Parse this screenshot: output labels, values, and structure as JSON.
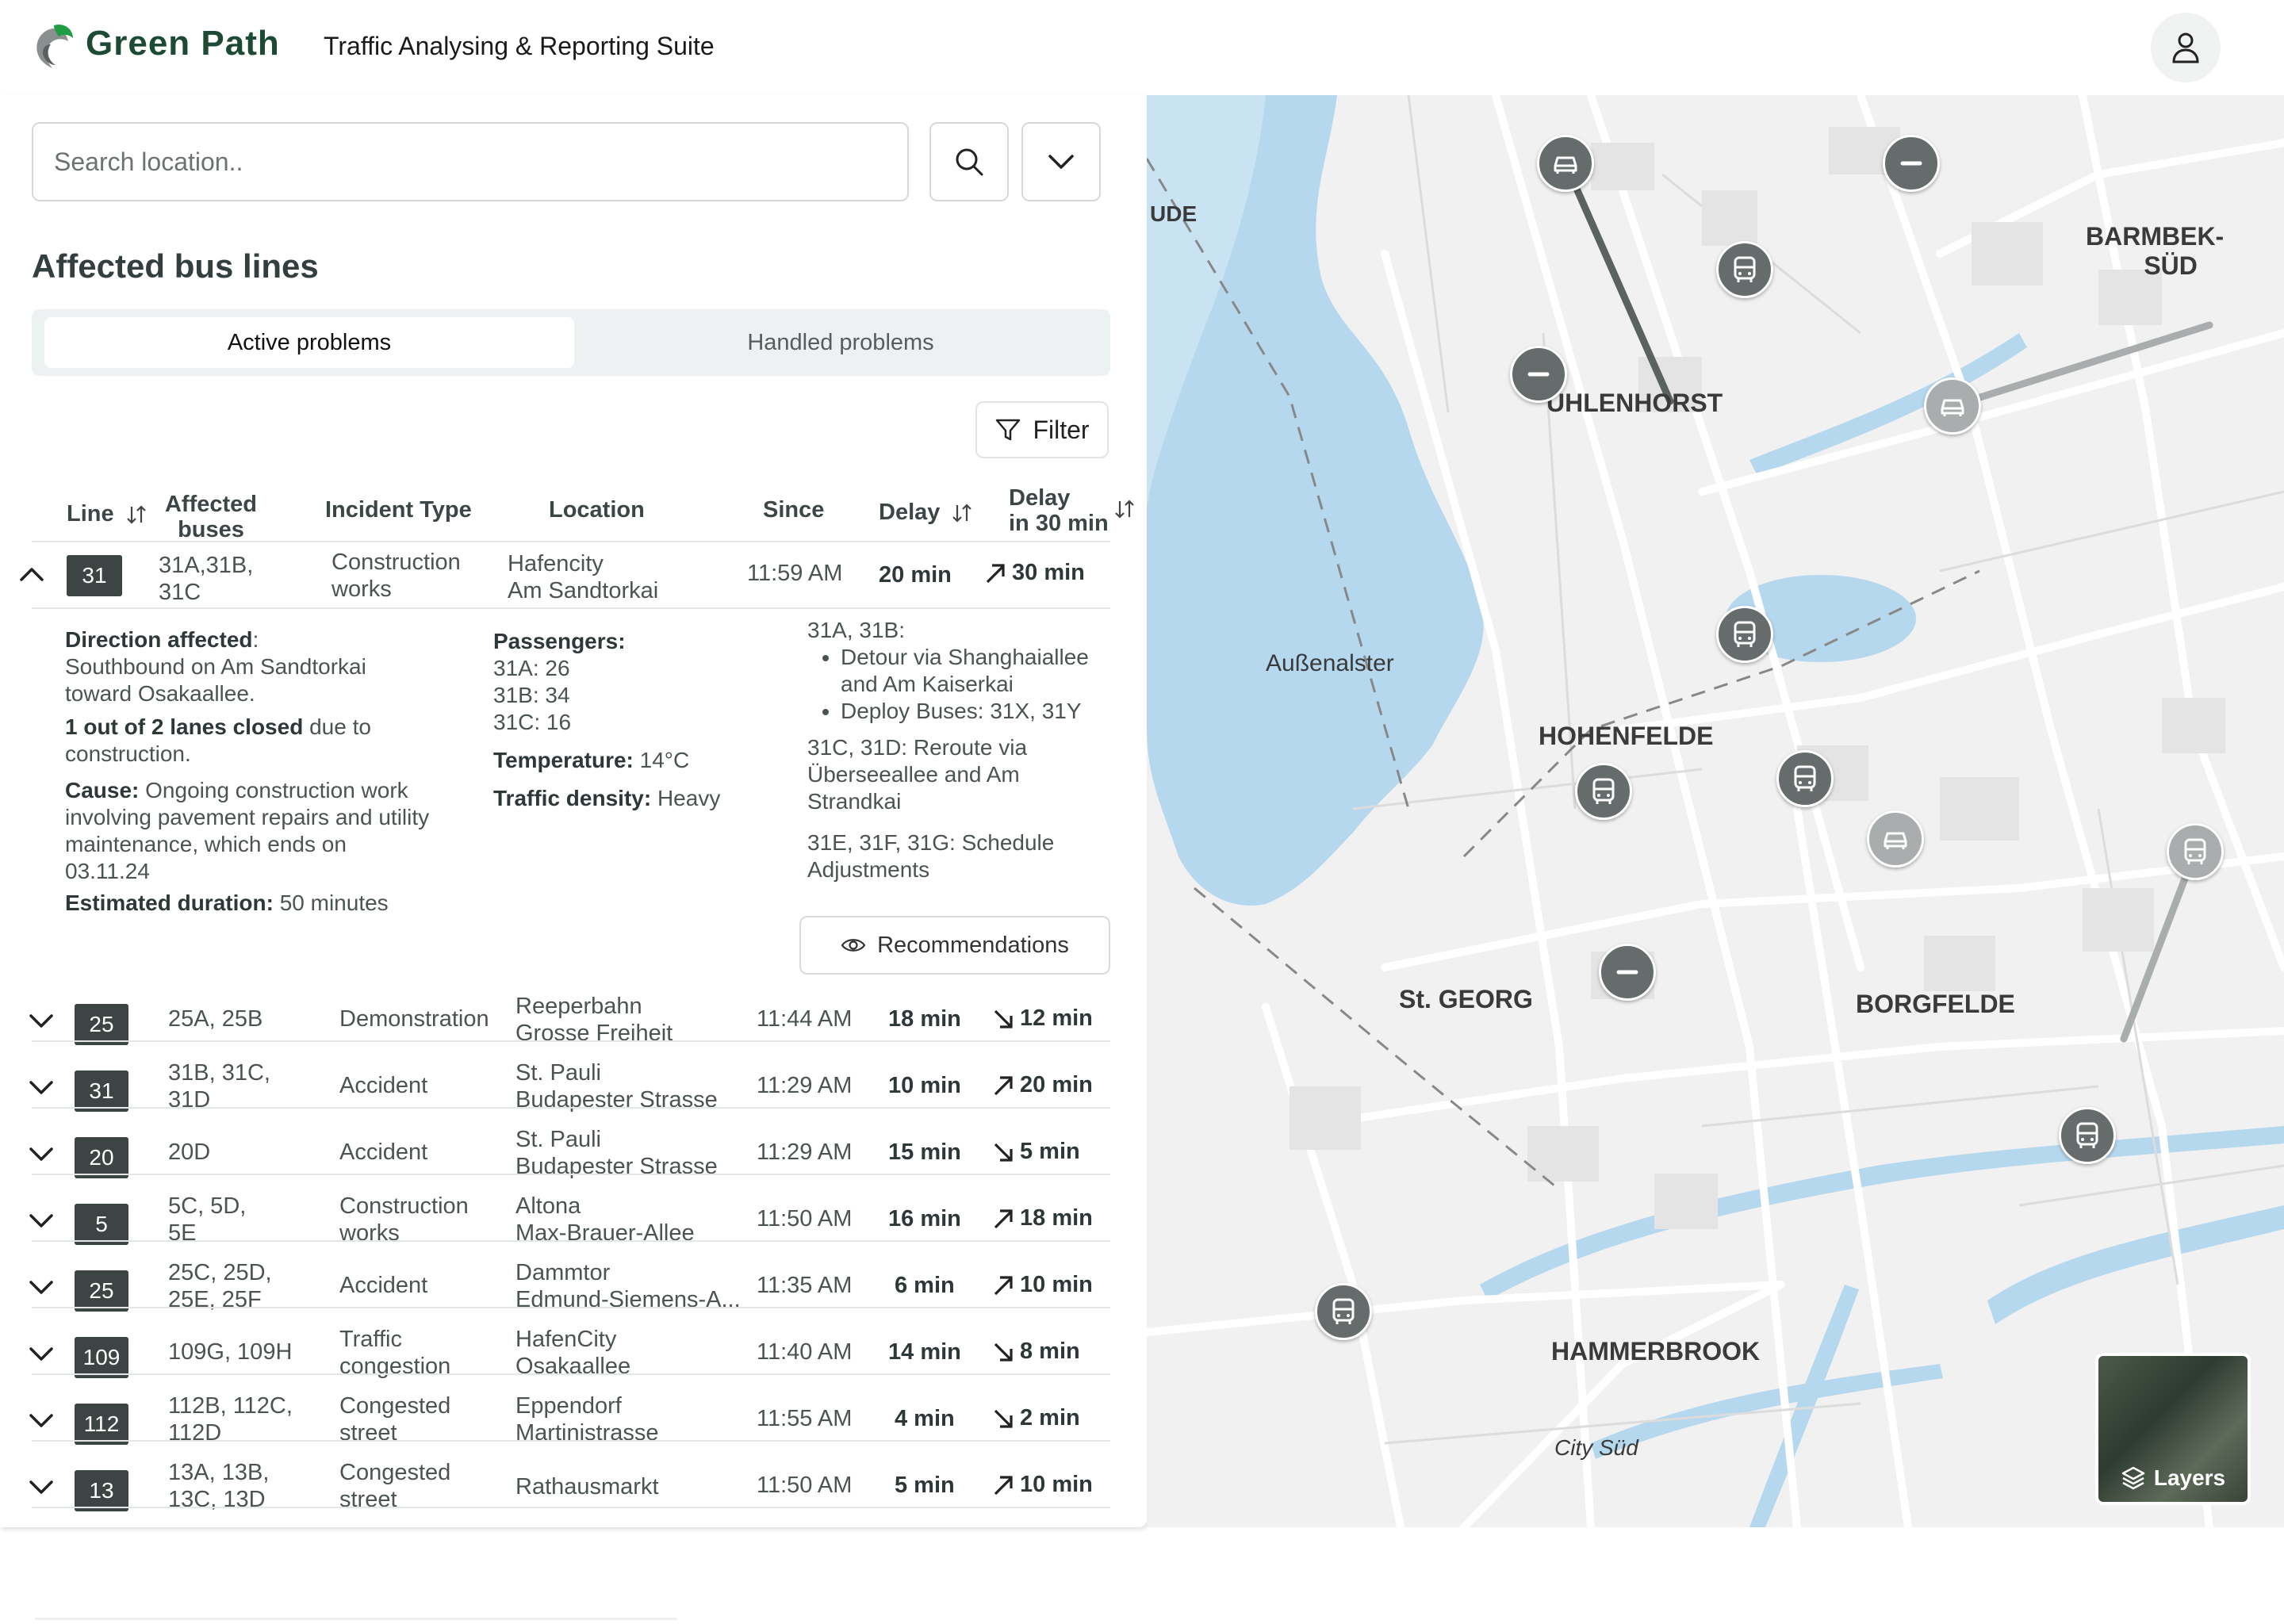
{
  "header": {
    "brand": "Green Path",
    "subtitle": "Traffic Analysing & Reporting Suite"
  },
  "search": {
    "placeholder": "Search location.."
  },
  "panel": {
    "title": "Affected bus lines",
    "tabs": [
      "Active problems",
      "Handled problems"
    ],
    "filter_label": "Filter"
  },
  "table": {
    "headers": {
      "line": "Line",
      "affected_1": "Affected",
      "affected_2": "buses",
      "incident": "Incident Type",
      "location": "Location",
      "since": "Since",
      "delay": "Delay",
      "delay30_1": "Delay",
      "delay30_2": "in 30 min"
    },
    "expanded": {
      "line": "31",
      "buses_1": "31A,31B,",
      "buses_2": "31C",
      "incident_1": "Construction",
      "incident_2": "works",
      "location_1": "Hafencity",
      "location_2": "Am Sandtorkai",
      "since": "11:59 AM",
      "delay": "20 min",
      "delay30": "30 min",
      "trend": "up"
    },
    "rows": [
      {
        "line": "25",
        "buses_1": "25A, 25B",
        "buses_2": "",
        "incident_1": "Demonstration",
        "incident_2": "",
        "location_1": "Reeperbahn",
        "location_2": "Grosse Freiheit",
        "since": "11:44 AM",
        "delay": "18 min",
        "delay30": "12 min",
        "trend": "down"
      },
      {
        "line": "31",
        "buses_1": "31B, 31C,",
        "buses_2": "31D",
        "incident_1": "Accident",
        "incident_2": "",
        "location_1": "St. Pauli",
        "location_2": "Budapester Strasse",
        "since": "11:29 AM",
        "delay": "10 min",
        "delay30": "20 min",
        "trend": "up"
      },
      {
        "line": "20",
        "buses_1": "20D",
        "buses_2": "",
        "incident_1": "Accident",
        "incident_2": "",
        "location_1": "St. Pauli",
        "location_2": "Budapester Strasse",
        "since": "11:29 AM",
        "delay": "15 min",
        "delay30": "5 min",
        "trend": "down"
      },
      {
        "line": "5",
        "buses_1": "5C, 5D,",
        "buses_2": "5E",
        "incident_1": "Construction",
        "incident_2": "works",
        "location_1": "Altona",
        "location_2": "Max-Brauer-Allee",
        "since": "11:50 AM",
        "delay": "16 min",
        "delay30": "18 min",
        "trend": "up"
      },
      {
        "line": "25",
        "buses_1": "25C, 25D,",
        "buses_2": "25E, 25F",
        "incident_1": "Accident",
        "incident_2": "",
        "location_1": "Dammtor",
        "location_2": "Edmund-Siemens-A...",
        "since": "11:35 AM",
        "delay": "6 min",
        "delay30": "10 min",
        "trend": "up"
      },
      {
        "line": "109",
        "buses_1": "109G, 109H",
        "buses_2": "",
        "incident_1": "Traffic",
        "incident_2": "congestion",
        "location_1": "HafenCity",
        "location_2": "Osakaallee",
        "since": "11:40 AM",
        "delay": "14 min",
        "delay30": "8 min",
        "trend": "down"
      },
      {
        "line": "112",
        "buses_1": "112B, 112C,",
        "buses_2": "112D",
        "incident_1": "Congested",
        "incident_2": "street",
        "location_1": "Eppendorf",
        "location_2": "Martinistrasse",
        "since": "11:55 AM",
        "delay": "4 min",
        "delay30": "2 min",
        "trend": "down"
      },
      {
        "line": "13",
        "buses_1": "13A, 13B,",
        "buses_2": "13C, 13D",
        "incident_1": "Congested",
        "incident_2": "street",
        "location_1": "",
        "location_2": "Rathausmarkt",
        "since": "11:50 AM",
        "delay": "5 min",
        "delay30": "10 min",
        "trend": "up"
      }
    ]
  },
  "details": {
    "direction_label": "Direction affected",
    "direction_text": "Southbound on Am Sandtorkai toward Osakaallee.",
    "lanes_bold": "1 out of 2 lanes closed",
    "lanes_text": " due to construction.",
    "cause_label": "Cause:",
    "cause_text": " Ongoing construction work involving pavement repairs and utility maintenance, which ends on 03.11.24",
    "duration_label": "Estimated duration:",
    "duration_text": " 50 minutes",
    "passengers_label": "Passengers:",
    "passengers": [
      "31A: 26",
      "31B: 34",
      "31C: 16"
    ],
    "temperature_label": "Temperature:",
    "temperature_value": " 14°C",
    "density_label": "Traffic density:",
    "density_value": " Heavy",
    "rec_heading": "31A, 31B:",
    "rec_bullets": [
      "Detour via Shanghaiallee and Am Kaiserkai",
      "Deploy Buses: 31X, 31Y"
    ],
    "rec_2": "31C, 31D: Reroute via Überseeallee and Am Strandkai",
    "rec_3": "31E, 31F, 31G: Schedule Adjustments",
    "rec_button": "Recommendations"
  },
  "map": {
    "labels": {
      "barmbek_1": "BARMBEK-",
      "barmbek_2": "SÜD",
      "uhlenhorst": "UHLENHORST",
      "aussenalster": "Außenalster",
      "hohenfelde": "HOHENFELDE",
      "stgeorg": "St. GEORG",
      "borgfelde": "BORGFELDE",
      "hammerbrook": "HAMMERBROOK",
      "citysued": "City Süd",
      "ude": "UDE"
    },
    "layers_label": "Layers",
    "colors": {
      "water": "#b5d8ee",
      "land": "#f1f1f1",
      "road": "#ffffff",
      "marker": "#666c6c"
    }
  }
}
